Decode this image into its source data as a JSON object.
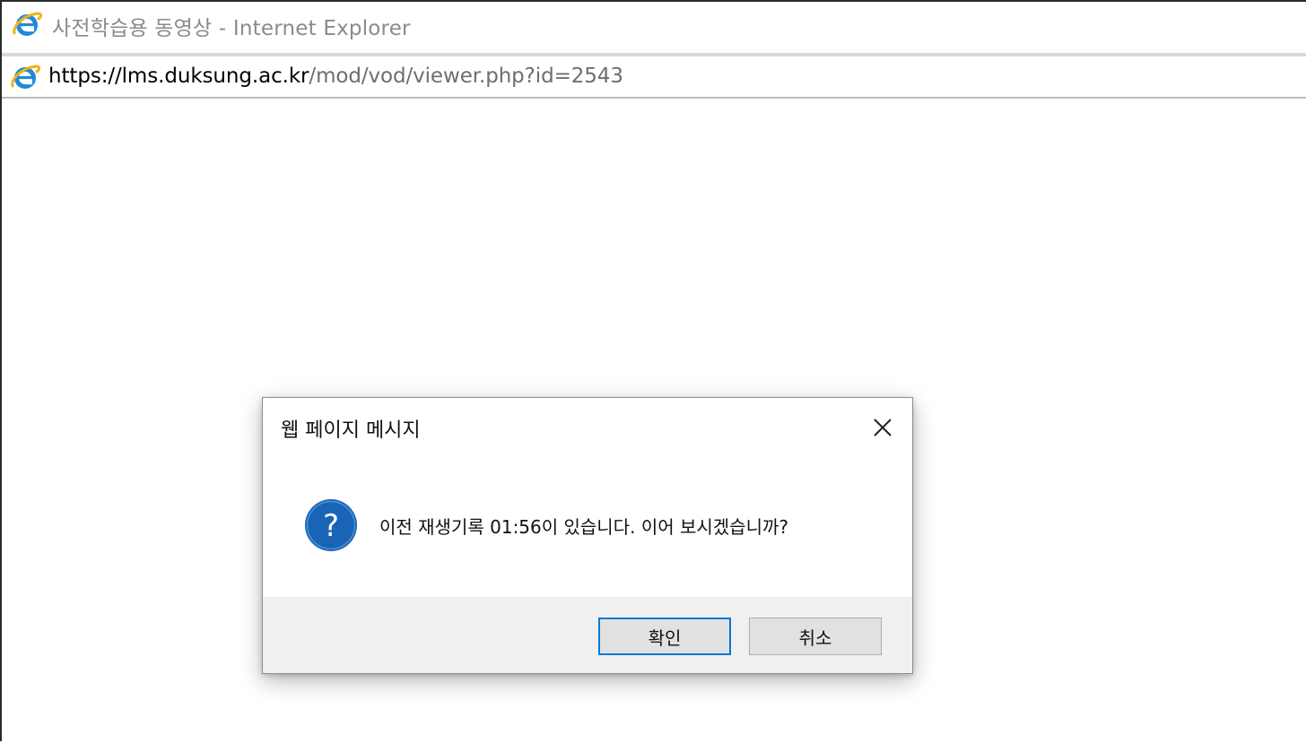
{
  "window": {
    "title": "사전학습용 동영상 - Internet Explorer",
    "app_icon": "ie-icon"
  },
  "address": {
    "url_prefix": "https://lms.",
    "url_domain": "duksung.ac.kr",
    "url_path": "/mod/vod/viewer.php?id=2543"
  },
  "dialog": {
    "title": "웹 페이지 메시지",
    "close_icon": "close-icon",
    "message": "이전 재생기록 01:56이 있습니다. 이어 보시겠습니까?",
    "icon": "question-icon",
    "ok_label": "확인",
    "cancel_label": "취소"
  },
  "colors": {
    "accent": "#0078d7",
    "question_blue": "#1a64b7",
    "footer_bg": "#f0f0f0"
  }
}
